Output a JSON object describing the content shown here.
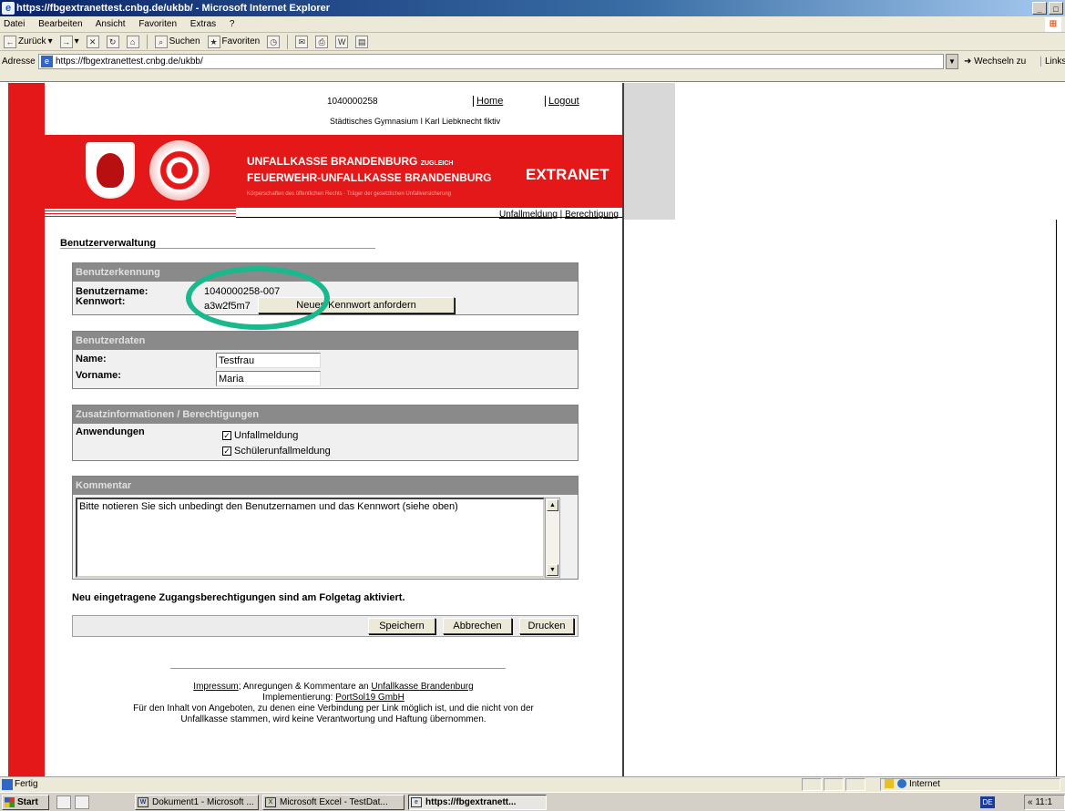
{
  "window": {
    "title": "https://fbgextranettest.cnbg.de/ukbb/ - Microsoft Internet Explorer",
    "buttons": [
      "_",
      "□"
    ]
  },
  "menubar": [
    "Datei",
    "Bearbeiten",
    "Ansicht",
    "Favoriten",
    "Extras",
    "?"
  ],
  "toolbar": {
    "back": "Zurück",
    "search": "Suchen",
    "favorites": "Favoriten"
  },
  "addressbar": {
    "label": "Adresse",
    "url": "https://fbgextranettest.cnbg.de/ukbb/",
    "go": "Wechseln zu",
    "links": "Links"
  },
  "header": {
    "user_id": "1040000258",
    "home": "Home",
    "logout": "Logout",
    "school": "Städtisches Gymnasium I Karl Liebknecht fiktiv"
  },
  "banner": {
    "line1": "UNFALLKASSE BRANDENBURG",
    "line1_small": "ZUGLEICH",
    "line2": "FEUERWEHR-UNFALLKASSE BRANDENBURG",
    "extranet": "EXTRANET",
    "subline": "Körperschaften des öffentlichen Rechts · Träger der gesetzlichen Unfallversicherung"
  },
  "sublinks": {
    "unfallmeldung": "Unfallmeldung",
    "berechtigung": "Berechtigung"
  },
  "page_title": "Benutzerverwaltung",
  "benutzerkennung": {
    "header": "Benutzerkennung",
    "username_label": "Benutzername:",
    "username_value": "1040000258-007",
    "password_label": "Kennwort:",
    "password_value": "a3w2f5m7",
    "new_password_button": "Neues Kennwort anfordern"
  },
  "benutzerdaten": {
    "header": "Benutzerdaten",
    "name_label": "Name:",
    "name_value": "Testfrau",
    "vorname_label": "Vorname:",
    "vorname_value": "Maria"
  },
  "zusatz": {
    "header": "Zusatzinformationen / Berechtigungen",
    "apps_label": "Anwendungen",
    "apps": [
      {
        "label": "Unfallmeldung",
        "checked": true
      },
      {
        "label": "Schülerunfallmeldung",
        "checked": true
      }
    ]
  },
  "kommentar": {
    "header": "Kommentar",
    "text": "Bitte notieren Sie sich unbedingt den Benutzernamen und das Kennwort (siehe oben)"
  },
  "notice": "Neu eingetragene Zugangsberechtigungen sind am Folgetag aktiviert.",
  "actions": {
    "save": "Speichern",
    "cancel": "Abbrechen",
    "print": "Drucken"
  },
  "footer": {
    "impressum": "Impressum",
    "anregungen_text": "; Anregungen & Kommentare an",
    "ukbb_link": "Unfallkasse Brandenburg",
    "impl_text": "Implementierung:",
    "impl_link": "PortSol19 GmbH",
    "disclaimer1": "Für den Inhalt von Angeboten, zu denen eine Verbindung per Link möglich ist, und die nicht von der",
    "disclaimer2": "Unfallkasse stammen, wird keine Verantwortung und Haftung übernommen."
  },
  "statusbar": {
    "text": "Fertig",
    "zone": "Internet"
  },
  "taskbar": {
    "start": "Start",
    "tasks": [
      "Dokument1 - Microsoft ...",
      "Microsoft Excel - TestDat...",
      "https://fbgextranett..."
    ],
    "lang": "DE",
    "clock": "« 11:1"
  },
  "colors": {
    "brand_red": "#e41818",
    "highlight_ellipse": "#1ab88c",
    "section_header": "#8a8a8a"
  }
}
